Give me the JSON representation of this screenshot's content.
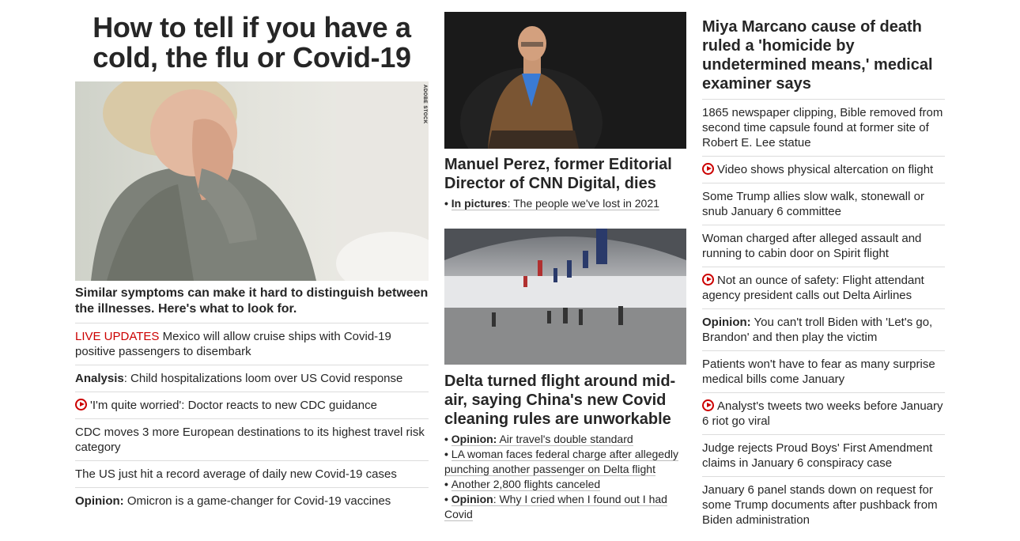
{
  "left": {
    "headline": "How to tell if you have a cold, the flu or Covid-19",
    "image_credit": "ADOBE STOCK",
    "subhead": "Similar symptoms can make it hard to distinguish between the illnesses. Here's what to look for.",
    "stories": [
      {
        "label": "LIVE UPDATES",
        "text": " Mexico will allow cruise ships with Covid-19 positive passengers to disembark"
      },
      {
        "label": "Analysis",
        "text": ": Child hospitalizations loom over US Covid response"
      },
      {
        "text": "'I'm quite worried': Doctor reacts to new CDC guidance",
        "video": true
      },
      {
        "text": "CDC moves 3 more European destinations to its highest travel risk category"
      },
      {
        "text": "The US just hit a record average of daily new Covid-19 cases"
      },
      {
        "label": "Opinion:",
        "text": " Omicron is a game-changer for Covid-19 vaccines"
      }
    ]
  },
  "middle": {
    "card1": {
      "title": "Manuel Perez, former Editorial Director of CNN Digital, dies",
      "related": [
        {
          "lead": "In pictures",
          "text": ": The people we've lost in 2021"
        }
      ]
    },
    "card2": {
      "title": "Delta turned flight around mid-air, saying China's new Covid cleaning rules are unworkable",
      "related": [
        {
          "lead": "Opinion:",
          "text": " Air travel's double standard"
        },
        {
          "text": "LA woman faces federal charge after allegedly punching another passenger on Delta flight"
        },
        {
          "text": "Another 2,800 flights canceled"
        },
        {
          "lead": "Opinion",
          "text": ": Why I cried when I found out I had Covid"
        }
      ]
    }
  },
  "right": {
    "headline": "Miya Marcano cause of death ruled a 'homicide by undetermined means,' medical examiner says",
    "stories": [
      {
        "text": "1865 newspaper clipping, Bible removed from second time capsule found at former site of Robert E. Lee statue"
      },
      {
        "text": "Video shows physical altercation on flight",
        "video": true
      },
      {
        "text": "Some Trump allies slow walk, stonewall or snub January 6 committee"
      },
      {
        "text": "Woman charged after alleged assault and running to cabin door on Spirit flight"
      },
      {
        "text": "Not an ounce of safety: Flight attendant agency president calls out Delta Airlines",
        "video": true
      },
      {
        "label": "Opinion:",
        "text": " You can't troll Biden with 'Let's go, Brandon' and then play the victim"
      },
      {
        "text": "Patients won't have to fear as many surprise medical bills come January"
      },
      {
        "text": "Analyst's tweets two weeks before January 6 riot go viral",
        "video": true
      },
      {
        "text": "Judge rejects Proud Boys' First Amendment claims in January 6 conspiracy case"
      },
      {
        "text": "January 6 panel stands down on request for some Trump documents after pushback from Biden administration"
      }
    ]
  },
  "colors": {
    "accent_red": "#cc0000",
    "text": "#262626",
    "divider": "#dcdcdc"
  }
}
